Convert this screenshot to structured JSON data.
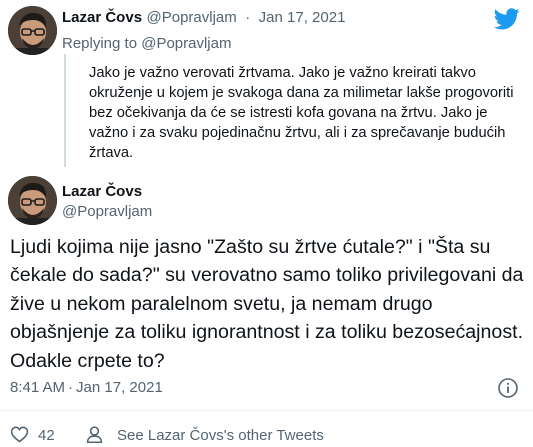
{
  "reply_tweet": {
    "display_name": "Lazar Čovs",
    "handle": "@Popravljam",
    "separator": "·",
    "date": "Jan 17, 2021",
    "replying_to_prefix": "Replying to",
    "replying_to_handle": "@Popravljam",
    "text": "Jako je važno verovati žrtvama. Jako je važno kreirati takvo okruženje u kojem je svakoga dana za milimetar lakše progovoriti bez očekivanja da će se istresti kofa govana na žrtvu. Jako je važno i za svaku pojedinačnu žrtvu, ali i za sprečavanje budućih žrtava."
  },
  "main_tweet": {
    "display_name": "Lazar Čovs",
    "handle": "@Popravljam",
    "text": "Ljudi kojima nije jasno \"Zašto su žrtve ćutale?\" i \"Šta su čekale do sada?\" su verovatno samo toliko privilegovani da žive u nekom paralelnom svetu, ja nemam drugo objašnjenje za toliku ignorantnost i za toliku bezosećajnost. Odakle crpete to?",
    "time": "8:41 AM",
    "separator": "·",
    "date": "Jan 17, 2021"
  },
  "footer": {
    "like_count": "42",
    "see_other_label": "See Lazar Čovs's other Tweets"
  },
  "colors": {
    "text": "#0f1419",
    "muted": "#536471",
    "twitter_blue": "#1d9bf0",
    "divider": "#eff3f4"
  },
  "icons": [
    "twitter-bird-icon",
    "info-icon",
    "heart-icon",
    "user-icon"
  ]
}
